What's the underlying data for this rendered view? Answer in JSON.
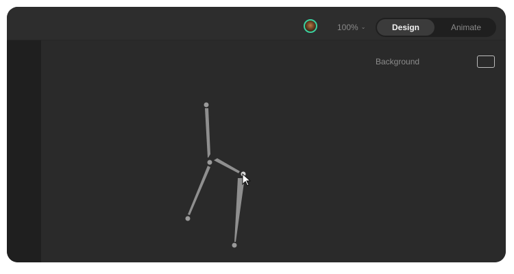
{
  "toolbar": {
    "avatar_icon": "profile-avatar",
    "avatar_ring_color": "#3ad1a0",
    "zoom_level": "100%",
    "zoom_chevron": "chevron-down-icon",
    "modes": [
      {
        "label": "Design",
        "active": true
      },
      {
        "label": "Animate",
        "active": false
      }
    ]
  },
  "inspector": {
    "background_label": "Background",
    "background_color": "#2a2a2a"
  },
  "canvas": {
    "shape": "stick-figure-bones",
    "bone_color": "#8f8f8f",
    "cursor": "arrow-pointer-icon"
  }
}
